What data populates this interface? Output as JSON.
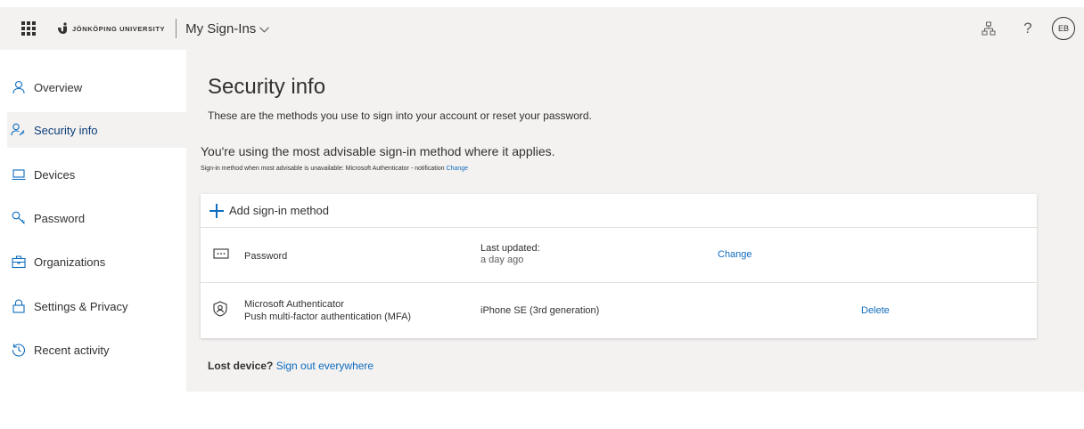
{
  "header": {
    "logo_text": "JÖNKÖPING UNIVERSITY",
    "app_title": "My Sign-Ins",
    "avatar_initials": "EB",
    "help_glyph": "?"
  },
  "sidebar": {
    "items": [
      {
        "label": "Overview",
        "icon": "person-icon"
      },
      {
        "label": "Security info",
        "icon": "person-key-icon",
        "active": true
      },
      {
        "label": "Devices",
        "icon": "laptop-icon"
      },
      {
        "label": "Password",
        "icon": "key-icon"
      },
      {
        "label": "Organizations",
        "icon": "briefcase-icon"
      },
      {
        "label": "Settings & Privacy",
        "icon": "lock-icon"
      },
      {
        "label": "Recent activity",
        "icon": "history-icon"
      }
    ]
  },
  "main": {
    "title": "Security info",
    "description": "These are the methods you use to sign into your account or reset your password.",
    "advisable_heading": "You're using the most advisable sign-in method where it applies.",
    "advisable_sub": "Sign-in method when most advisable is unavailable: Microsoft Authenticator - notification",
    "advisable_change": "Change",
    "add_method": "Add sign-in method",
    "methods": [
      {
        "name": "Password",
        "detail_label": "Last updated:",
        "detail_value": "a day ago",
        "action": "Change"
      },
      {
        "name": "Microsoft Authenticator",
        "subname": "Push multi-factor authentication (MFA)",
        "detail_value": "iPhone SE (3rd generation)",
        "action": "Delete"
      }
    ],
    "lost_device_label": "Lost device?",
    "lost_device_link": "Sign out everywhere"
  },
  "colors": {
    "accent": "#0f6cbd",
    "active_nav_text": "#0b3d78",
    "main_bg": "#f3f2f1"
  }
}
